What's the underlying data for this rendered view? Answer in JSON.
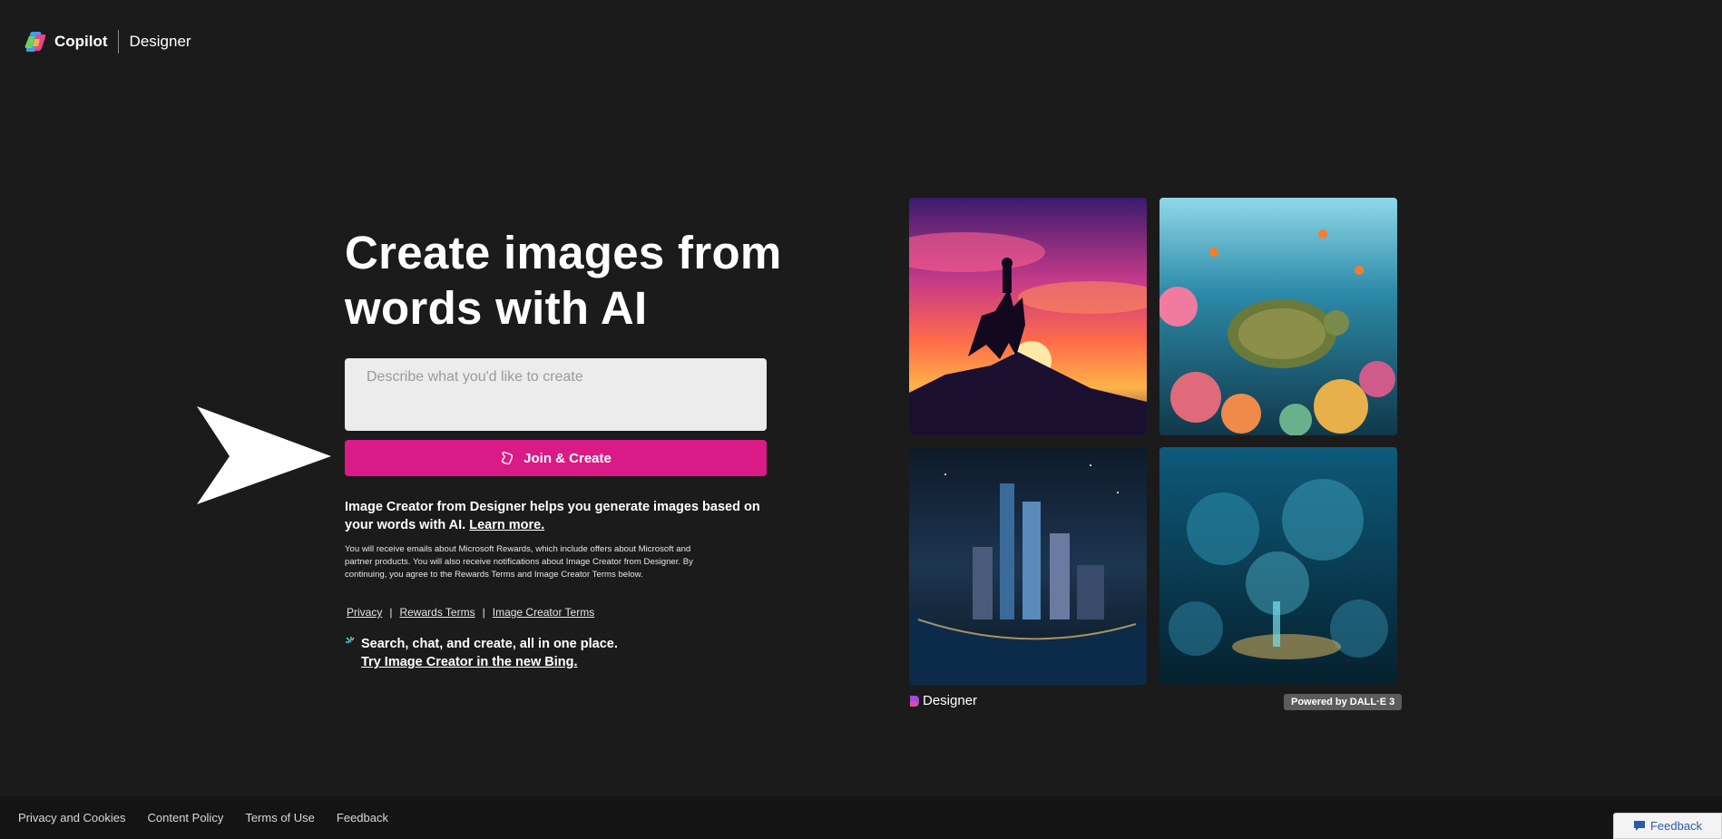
{
  "header": {
    "logo_icon": "copilot-logo-icon",
    "brand": "Copilot",
    "product": "Designer"
  },
  "hero": {
    "title": "Create images from words with AI"
  },
  "prompt": {
    "placeholder": "Describe what you'd like to create",
    "value": ""
  },
  "join_button": {
    "label": "Join & Create",
    "icon": "rewards-icon",
    "color": "#da1a87"
  },
  "description": {
    "text": "Image Creator from Designer helps you generate images based on your words with AI.",
    "learn_more": "Learn more."
  },
  "fine_print": "You will receive emails about Microsoft Rewards, which include offers about Microsoft and partner products. You will also receive notifications about Image Creator from Designer. By continuing, you agree to the Rewards Terms and Image Creator Terms below.",
  "terms_links": {
    "privacy": "Privacy",
    "rewards": "Rewards Terms",
    "image_creator": "Image Creator Terms",
    "separator": "|"
  },
  "bing_promo": {
    "icon": "sparkle-icon",
    "line1": "Search, chat, and create, all in one place.",
    "link": "Try Image Creator in the new Bing."
  },
  "gallery": {
    "tiles": [
      {
        "icon": "cowboy-sunset-image"
      },
      {
        "icon": "sea-turtle-reef-image"
      },
      {
        "icon": "night-city-image"
      },
      {
        "icon": "underwater-city-image"
      }
    ],
    "designer_label": "Designer",
    "powered_by": "Powered by DALL·E 3"
  },
  "footer": {
    "links": [
      "Privacy and Cookies",
      "Content Policy",
      "Terms of Use",
      "Feedback"
    ],
    "feedback_button": "Feedback"
  }
}
